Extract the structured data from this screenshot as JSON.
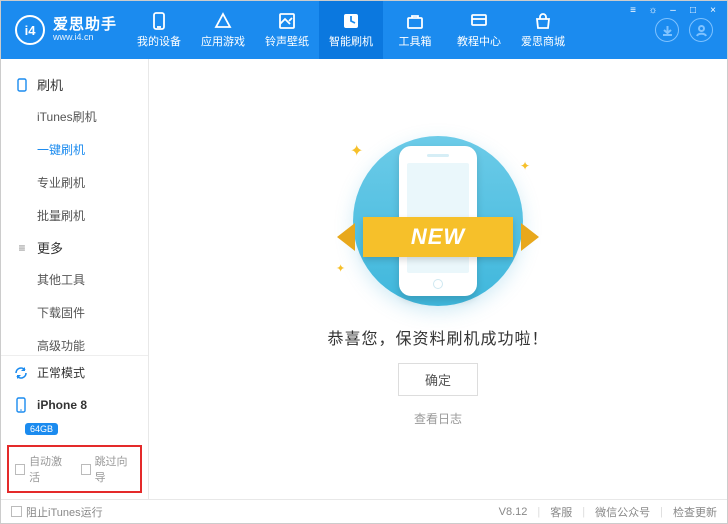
{
  "app": {
    "name_cn": "爱思助手",
    "url": "www.i4.cn",
    "logo_text": "i4"
  },
  "winctrl": {
    "menu": "≡",
    "skin": "☼",
    "min": "–",
    "max": "□",
    "close": "×"
  },
  "nav": [
    {
      "key": "device",
      "label": "我的设备"
    },
    {
      "key": "apps",
      "label": "应用游戏"
    },
    {
      "key": "ringwall",
      "label": "铃声壁纸"
    },
    {
      "key": "flash",
      "label": "智能刷机",
      "active": true
    },
    {
      "key": "toolbox",
      "label": "工具箱"
    },
    {
      "key": "tutorial",
      "label": "教程中心"
    },
    {
      "key": "store",
      "label": "爱思商城"
    }
  ],
  "sidebar": {
    "groups": [
      {
        "key": "flash",
        "title": "刷机",
        "items": [
          {
            "key": "itunes",
            "label": "iTunes刷机"
          },
          {
            "key": "onekey",
            "label": "一键刷机",
            "active": true
          },
          {
            "key": "pro",
            "label": "专业刷机"
          },
          {
            "key": "batch",
            "label": "批量刷机"
          }
        ]
      },
      {
        "key": "more",
        "title": "更多",
        "items": [
          {
            "key": "othertools",
            "label": "其他工具"
          },
          {
            "key": "download",
            "label": "下载固件"
          },
          {
            "key": "advanced",
            "label": "高级功能"
          }
        ]
      }
    ],
    "mode": {
      "label": "正常模式"
    },
    "device": {
      "name": "iPhone 8",
      "storage": "64GB"
    },
    "checks": {
      "auto_activate": "自动激活",
      "skip_guide": "跳过向导"
    }
  },
  "main": {
    "banner_text": "NEW",
    "success": "恭喜您，保资料刷机成功啦！",
    "ok": "确定",
    "view_log": "查看日志"
  },
  "footer": {
    "block_itunes": "阻止iTunes运行",
    "version": "V8.12",
    "support": "客服",
    "wechat": "微信公众号",
    "update": "检查更新"
  }
}
